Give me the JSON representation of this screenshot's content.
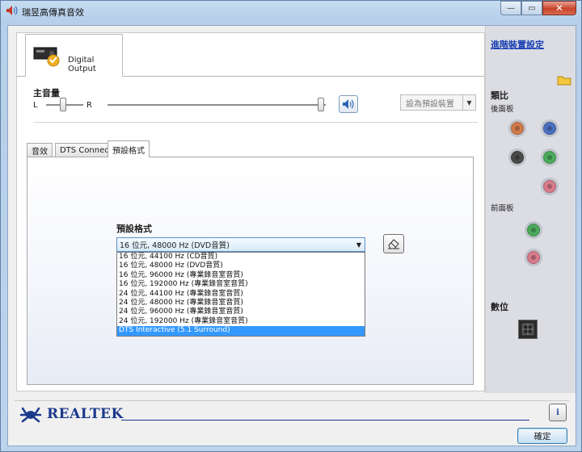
{
  "window": {
    "title": "瑞昱高傳真音效"
  },
  "device_tab": {
    "label": "Digital Output"
  },
  "volume": {
    "title": "主音量",
    "left_label": "L",
    "right_label": "R",
    "balance_level": 0.5,
    "volume_level": 0.97
  },
  "default_device": {
    "label": "設為預設裝置"
  },
  "tabs": [
    {
      "label": "音效"
    },
    {
      "label": "DTS Connect"
    },
    {
      "label": "預設格式"
    }
  ],
  "format": {
    "title": "預設格式",
    "selected": "16 位元, 48000 Hz (DVD音質)",
    "options": [
      "16 位元, 44100 Hz (CD音質)",
      "16 位元, 48000 Hz (DVD音質)",
      "16 位元, 96000 Hz (專業錄音室音質)",
      "16 位元, 192000 Hz (專業錄音室音質)",
      "24 位元, 44100 Hz (專業錄音室音質)",
      "24 位元, 48000 Hz (專業錄音室音質)",
      "24 位元, 96000 Hz (專業錄音室音質)",
      "24 位元, 192000 Hz (專業錄音室音質)",
      "DTS Interactive (5.1 Surround)"
    ],
    "highlighted": "DTS Interactive (5.1 Surround)"
  },
  "right_panel": {
    "advanced_link": "進階裝置設定",
    "analog_title": "類比",
    "rear_panel": "後面板",
    "front_panel": "前面板",
    "digital_title": "數位",
    "jack_colors": {
      "orange": "#d07a4a",
      "blue": "#4a6fc0",
      "black": "#4a4a4a",
      "green": "#4caa5c",
      "pink": "#d77a8a"
    }
  },
  "footer": {
    "brand": "REALTEK",
    "ok_label": "確定",
    "info_icon": "i"
  }
}
